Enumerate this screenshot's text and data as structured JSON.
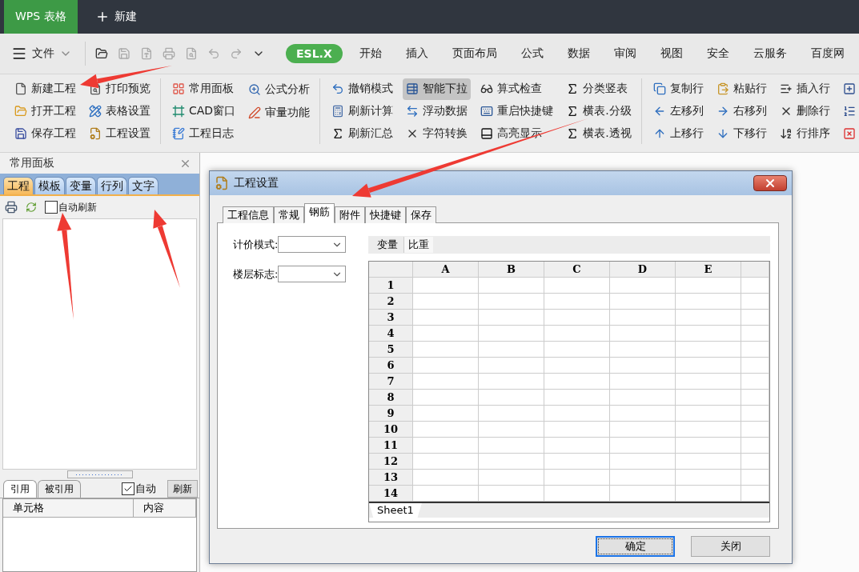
{
  "app_tabs": [
    {
      "label": "WPS 表格",
      "selected": true
    },
    {
      "label": "新建",
      "selected": false
    }
  ],
  "menu": {
    "file": "文件",
    "tabs": [
      {
        "label": "ESL.X",
        "selected": true
      },
      {
        "label": "开始",
        "selected": false
      },
      {
        "label": "插入",
        "selected": false
      },
      {
        "label": "页面布局",
        "selected": false
      },
      {
        "label": "公式",
        "selected": false
      },
      {
        "label": "数据",
        "selected": false
      },
      {
        "label": "审阅",
        "selected": false
      },
      {
        "label": "视图",
        "selected": false
      },
      {
        "label": "安全",
        "selected": false
      },
      {
        "label": "云服务",
        "selected": false
      },
      {
        "label": "百度网",
        "selected": false
      }
    ]
  },
  "ribbon": {
    "groups": [
      {
        "columns": [
          [
            {
              "label": "新建工程",
              "selected": false
            },
            {
              "label": "打开工程",
              "selected": false
            },
            {
              "label": "保存工程",
              "selected": false
            }
          ],
          [
            {
              "label": "打印预览",
              "selected": false
            },
            {
              "label": "表格设置",
              "selected": false
            },
            {
              "label": "工程设置",
              "selected": false
            }
          ]
        ]
      },
      {
        "columns": [
          [
            {
              "label": "常用面板",
              "selected": false
            },
            {
              "label": "CAD窗口",
              "selected": false
            },
            {
              "label": "工程日志",
              "selected": false
            }
          ],
          [
            {
              "label": "公式分析",
              "selected": false
            },
            {
              "label": "审量功能",
              "selected": false
            }
          ]
        ]
      },
      {
        "columns": [
          [
            {
              "label": "撤销模式",
              "selected": false
            },
            {
              "label": "刷新计算",
              "selected": false
            },
            {
              "label": "刷新汇总",
              "selected": false
            }
          ],
          [
            {
              "label": "智能下拉",
              "selected": true
            },
            {
              "label": "浮动数据",
              "selected": false
            },
            {
              "label": "字符转换",
              "selected": false
            }
          ],
          [
            {
              "label": "算式检查",
              "selected": false
            },
            {
              "label": "重启快捷键",
              "selected": false
            },
            {
              "label": "高亮显示",
              "selected": false
            }
          ],
          [
            {
              "label": "分类竖表",
              "selected": false
            },
            {
              "label": "横表.分级",
              "selected": false
            },
            {
              "label": "横表.透视",
              "selected": false
            }
          ]
        ]
      },
      {
        "columns": [
          [
            {
              "label": "复制行",
              "selected": false
            },
            {
              "label": "左移列",
              "selected": false
            },
            {
              "label": "上移行",
              "selected": false
            }
          ],
          [
            {
              "label": "粘贴行",
              "selected": false
            },
            {
              "label": "右移列",
              "selected": false
            },
            {
              "label": "下移行",
              "selected": false
            }
          ],
          [
            {
              "label": "插入行",
              "selected": false
            },
            {
              "label": "删除行",
              "selected": false
            },
            {
              "label": "行排序",
              "selected": false
            }
          ]
        ]
      }
    ]
  },
  "panel": {
    "title": "常用面板",
    "tabs": [
      {
        "label": "工程",
        "selected": true
      },
      {
        "label": "模板",
        "selected": false
      },
      {
        "label": "变量",
        "selected": false
      },
      {
        "label": "行列",
        "selected": false
      },
      {
        "label": "文字",
        "selected": false
      }
    ],
    "auto_refresh": {
      "label": "自动刷新",
      "checked": false
    },
    "ref_tabs": [
      {
        "label": "引用",
        "selected": true
      },
      {
        "label": "被引用",
        "selected": false
      }
    ],
    "auto": {
      "label": "自动",
      "checked": true
    },
    "refresh_button": "刷新",
    "columns": [
      "单元格",
      "内容"
    ]
  },
  "dialog": {
    "title": "工程设置",
    "tabs": [
      {
        "label": "工程信息",
        "selected": false
      },
      {
        "label": "常规",
        "selected": false
      },
      {
        "label": "钢筋",
        "selected": true
      },
      {
        "label": "附件",
        "selected": false
      },
      {
        "label": "快捷键",
        "selected": false
      },
      {
        "label": "保存",
        "selected": false
      }
    ],
    "fields": [
      {
        "label": "计价模式:"
      },
      {
        "label": "楼层标志:"
      }
    ],
    "sub_tabs": [
      {
        "label": "变量",
        "selected": false
      },
      {
        "label": "比重",
        "selected": true
      }
    ],
    "columns": [
      "A",
      "B",
      "C",
      "D",
      "E"
    ],
    "rows": [
      "1",
      "2",
      "3",
      "4",
      "5",
      "6",
      "7",
      "8",
      "9",
      "10",
      "11",
      "12",
      "13",
      "14"
    ],
    "sheet": "Sheet1",
    "buttons": [
      {
        "label": "确定",
        "selected": true
      },
      {
        "label": "关闭",
        "selected": false
      }
    ]
  }
}
